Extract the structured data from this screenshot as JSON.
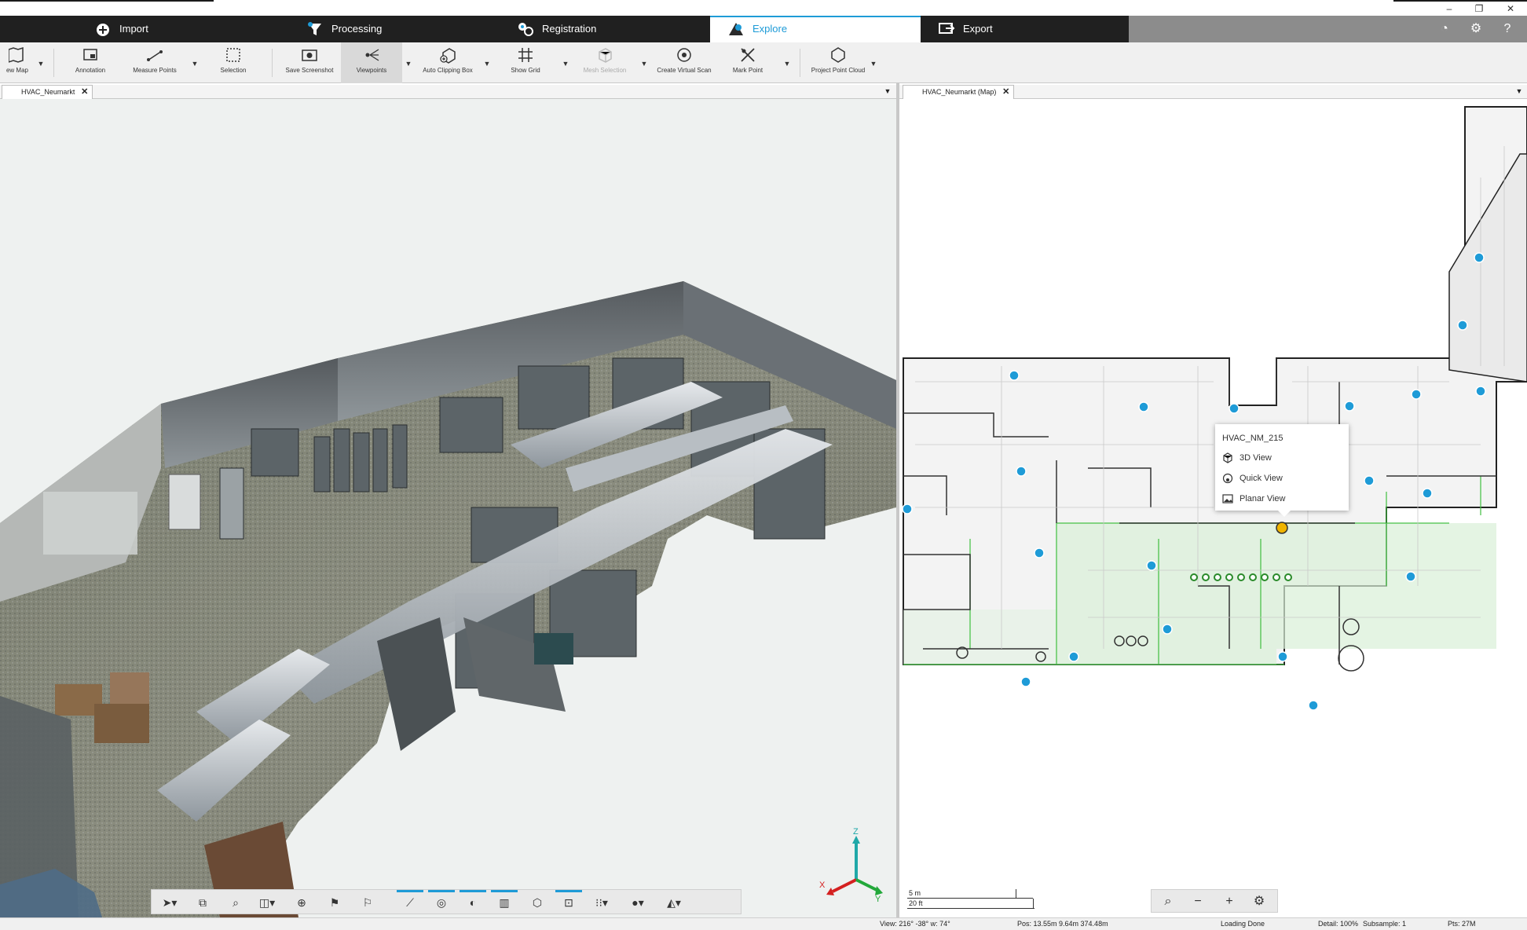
{
  "ribbon": {
    "tabs": [
      {
        "label": "Import",
        "icon": "import-icon"
      },
      {
        "label": "Processing",
        "icon": "processing-icon"
      },
      {
        "label": "Registration",
        "icon": "registration-icon"
      },
      {
        "label": "Explore",
        "icon": "explore-icon",
        "active": true
      },
      {
        "label": "Export",
        "icon": "export-icon"
      }
    ],
    "accent": "#1e9bd7"
  },
  "toolbar": {
    "tools": [
      {
        "label": "ew Map",
        "icon": "map-icon"
      },
      {
        "label": "Annotation",
        "icon": "annotation-icon"
      },
      {
        "label": "Measure Points",
        "icon": "measure-icon"
      },
      {
        "label": "Selection",
        "icon": "selection-icon"
      },
      {
        "label": "Save Screenshot",
        "icon": "screenshot-icon"
      },
      {
        "label": "Viewpoints",
        "icon": "viewpoints-icon"
      },
      {
        "label": "Auto Clipping Box",
        "icon": "clipping-box-icon"
      },
      {
        "label": "Show Grid",
        "icon": "grid-icon"
      },
      {
        "label": "Mesh Selection",
        "icon": "mesh-icon"
      },
      {
        "label": "Create Virtual Scan",
        "icon": "virtual-scan-icon"
      },
      {
        "label": "Mark Point",
        "icon": "mark-point-icon"
      },
      {
        "label": "Project Point Cloud",
        "icon": "project-cloud-icon"
      }
    ]
  },
  "left_pane": {
    "tab": "HVAC_Neumarkt"
  },
  "right_pane": {
    "tab": "HVAC_Neumarkt (Map)"
  },
  "popup": {
    "title": "HVAC_NM_215",
    "items": [
      "3D View",
      "Quick View",
      "Planar View"
    ]
  },
  "axis": {
    "x": "X",
    "y": "Y",
    "z": "Z"
  },
  "scale": {
    "metric": "5 m",
    "imperial": "20 ft"
  },
  "status": {
    "view": "View: 216° -38° w: 74°",
    "pos": "Pos: 13.55m 9.64m 374.48m",
    "loading": "Loading Done",
    "detail": "Detail: 100%",
    "subsample": "Subsample: 1",
    "pts": "Pts: 27M"
  }
}
